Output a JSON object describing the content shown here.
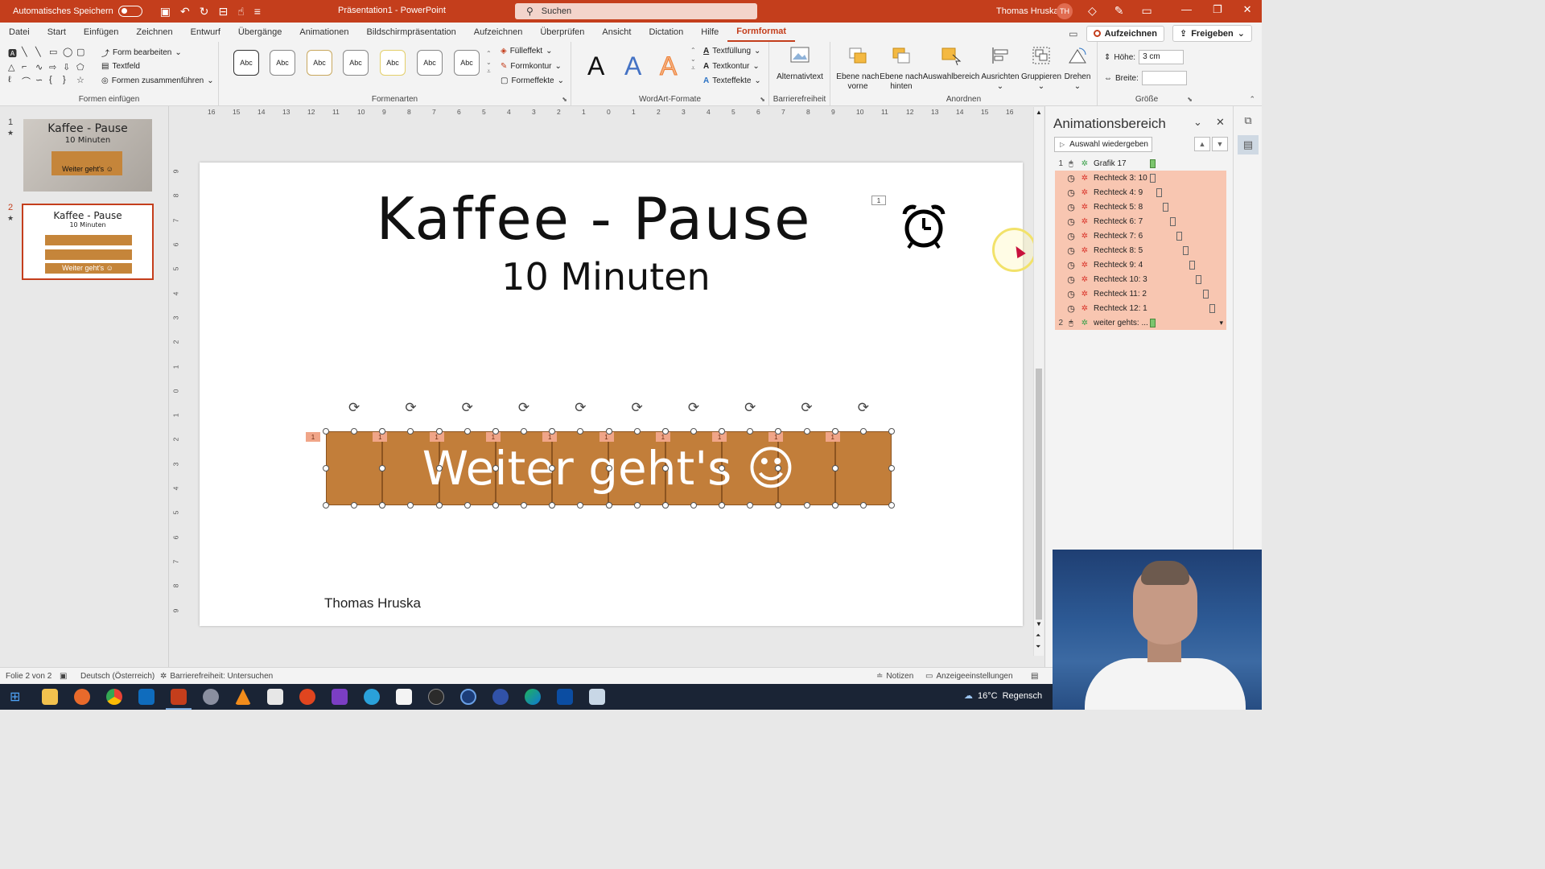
{
  "titlebar": {
    "autosave_label": "Automatisches Speichern",
    "title": "Präsentation1 - PowerPoint",
    "search_label": "Suchen",
    "user_name": "Thomas Hruska",
    "user_initials": "TH"
  },
  "tabs": [
    "Datei",
    "Start",
    "Einfügen",
    "Zeichnen",
    "Entwurf",
    "Übergänge",
    "Animationen",
    "Bildschirmpräsentation",
    "Aufzeichnen",
    "Überprüfen",
    "Ansicht",
    "Dictation",
    "Hilfe",
    "Formformat"
  ],
  "active_tab": "Formformat",
  "tab_buttons": {
    "record": "Aufzeichnen",
    "share": "Freigeben"
  },
  "ribbon": {
    "insert_shapes": {
      "edit_shape": "Form bearbeiten",
      "textbox": "Textfeld",
      "merge_shapes": "Formen zusammenführen",
      "label": "Formen einfügen"
    },
    "shape_styles": {
      "sample": "Abc",
      "fill": "Fülleffekt",
      "outline": "Formkontur",
      "effects": "Formeffekte",
      "label": "Formenarten"
    },
    "wordart": {
      "letter": "A",
      "text_fill": "Textfüllung",
      "text_outline": "Textkontur",
      "text_effects": "Texteffekte",
      "label": "WordArt-Formate"
    },
    "accessibility": {
      "alt_text": "Alternativtext",
      "label": "Barrierefreiheit"
    },
    "arrange": {
      "bring_forward": "Ebene nach vorne",
      "send_backward": "Ebene nach hinten",
      "selection_pane": "Auswahlbereich",
      "align": "Ausrichten",
      "group": "Gruppieren",
      "rotate": "Drehen",
      "label": "Anordnen"
    },
    "size": {
      "height_label": "Höhe:",
      "height_value": "3 cm",
      "width_label": "Breite:",
      "width_value": "",
      "label": "Größe"
    }
  },
  "thumbnails": {
    "slide1": {
      "number": "1",
      "title": "Kaffee - Pause",
      "subtitle": "10 Minuten",
      "bar_text": "Weiter geht's ☺"
    },
    "slide2": {
      "number": "2",
      "title": "Kaffee - Pause",
      "subtitle": "10 Minuten",
      "bar_text": "Weiter geht's ☺"
    }
  },
  "rulers": {
    "horizontal": [
      "16",
      "15",
      "14",
      "13",
      "12",
      "11",
      "10",
      "9",
      "8",
      "7",
      "6",
      "5",
      "4",
      "3",
      "2",
      "1",
      "0",
      "1",
      "2",
      "3",
      "4",
      "5",
      "6",
      "7",
      "8",
      "9",
      "10",
      "11",
      "12",
      "13",
      "14",
      "15",
      "16"
    ],
    "vertical": [
      "9",
      "8",
      "7",
      "6",
      "5",
      "4",
      "3",
      "2",
      "1",
      "0",
      "1",
      "2",
      "3",
      "4",
      "5",
      "6",
      "7",
      "8",
      "9"
    ]
  },
  "slide": {
    "title": "Kaffee - Pause",
    "subtitle": "10 Minuten",
    "button_text": "Weiter geht's ☺",
    "author": "Thomas Hruska",
    "anim_tag": "1",
    "alarm_icon": "alarm-clock-icon"
  },
  "animation_pane": {
    "title": "Animationsbereich",
    "play_selection": "Auswahl wiedergeben",
    "items": [
      {
        "num": "1",
        "label": "Grafik 17",
        "selected": false,
        "type": "start",
        "bar": "green"
      },
      {
        "num": "",
        "label": "Rechteck 3: 10",
        "selected": true,
        "type": "exit",
        "bar": "outline"
      },
      {
        "num": "",
        "label": "Rechteck 4: 9",
        "selected": true,
        "type": "exit",
        "bar": "outline"
      },
      {
        "num": "",
        "label": "Rechteck 5: 8",
        "selected": true,
        "type": "exit",
        "bar": "outline"
      },
      {
        "num": "",
        "label": "Rechteck 6: 7",
        "selected": true,
        "type": "exit",
        "bar": "outline"
      },
      {
        "num": "",
        "label": "Rechteck 7: 6",
        "selected": true,
        "type": "exit",
        "bar": "outline"
      },
      {
        "num": "",
        "label": "Rechteck 8: 5",
        "selected": true,
        "type": "exit",
        "bar": "outline"
      },
      {
        "num": "",
        "label": "Rechteck 9: 4",
        "selected": true,
        "type": "exit",
        "bar": "outline"
      },
      {
        "num": "",
        "label": "Rechteck 10: 3",
        "selected": true,
        "type": "exit",
        "bar": "outline"
      },
      {
        "num": "",
        "label": "Rechteck 11: 2",
        "selected": true,
        "type": "exit",
        "bar": "outline"
      },
      {
        "num": "",
        "label": "Rechteck 12: 1",
        "selected": true,
        "type": "exit",
        "bar": "outline"
      },
      {
        "num": "2",
        "label": "weiter gehts: ...",
        "selected": true,
        "type": "entrance",
        "bar": "green"
      }
    ]
  },
  "statusbar": {
    "slide_info": "Folie 2 von 2",
    "language": "Deutsch (Österreich)",
    "accessibility": "Barrierefreiheit: Untersuchen",
    "notes": "Notizen",
    "display_settings": "Anzeigeeinstellungen"
  },
  "taskbar": {
    "temperature": "16°C",
    "weather": "Regensch"
  },
  "colors": {
    "accent": "#c43e1c",
    "bar": "#c27e3a",
    "selection": "#f8c6b1",
    "tag": "#f0a588"
  }
}
